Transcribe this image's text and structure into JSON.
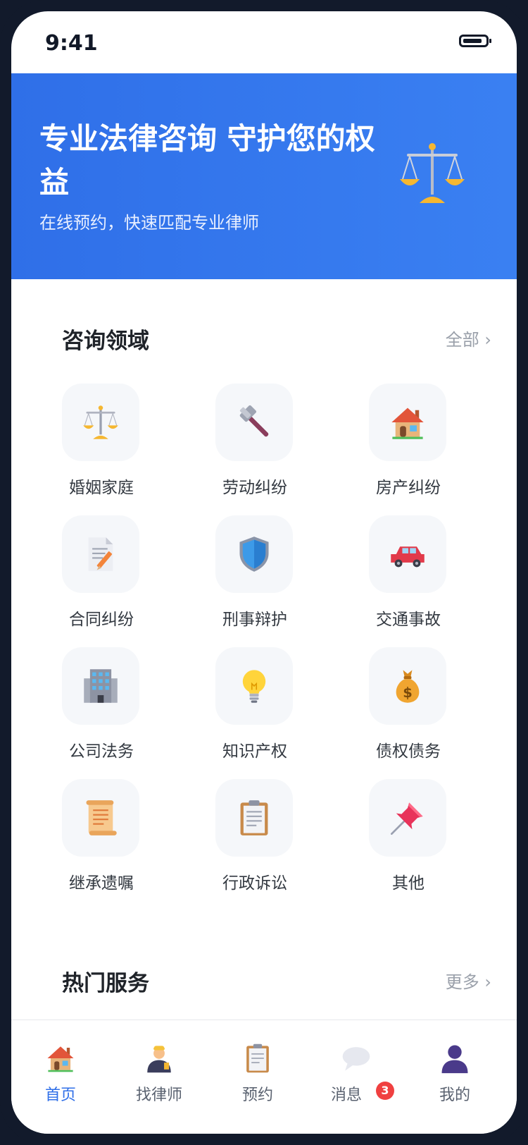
{
  "status_bar": {
    "time": "9:41",
    "battery_level": 0.85
  },
  "hero": {
    "title": "专业法律咨询 守护您的权益",
    "subtitle": "在线预约，快速匹配专业律师",
    "icon": "scale-icon"
  },
  "consult_section": {
    "title": "咨询领域",
    "link_label": "全部",
    "categories": [
      {
        "label": "婚姻家庭",
        "icon": "scale-icon"
      },
      {
        "label": "劳动纠纷",
        "icon": "hammer-icon"
      },
      {
        "label": "房产纠纷",
        "icon": "house-icon"
      },
      {
        "label": "合同纠纷",
        "icon": "contract-icon"
      },
      {
        "label": "刑事辩护",
        "icon": "shield-icon"
      },
      {
        "label": "交通事故",
        "icon": "car-icon"
      },
      {
        "label": "公司法务",
        "icon": "building-icon"
      },
      {
        "label": "知识产权",
        "icon": "lightbulb-icon"
      },
      {
        "label": "债权债务",
        "icon": "money-bag-icon"
      },
      {
        "label": "继承遗嘱",
        "icon": "scroll-icon"
      },
      {
        "label": "行政诉讼",
        "icon": "clipboard-icon"
      },
      {
        "label": "其他",
        "icon": "pin-icon"
      }
    ]
  },
  "hot_section": {
    "title": "热门服务",
    "link_label": "更多"
  },
  "tab_bar": {
    "tabs": [
      {
        "label": "首页",
        "icon": "home-icon",
        "active": true
      },
      {
        "label": "找律师",
        "icon": "lawyer-icon",
        "active": false
      },
      {
        "label": "预约",
        "icon": "clipboard-icon",
        "active": false
      },
      {
        "label": "消息",
        "icon": "chat-bubble-icon",
        "active": false,
        "badge": "3"
      },
      {
        "label": "我的",
        "icon": "user-icon",
        "active": false
      }
    ]
  },
  "colors": {
    "accent": "#2f6fe8",
    "badge": "#f04040",
    "hero_bg": "#3a80f2"
  }
}
